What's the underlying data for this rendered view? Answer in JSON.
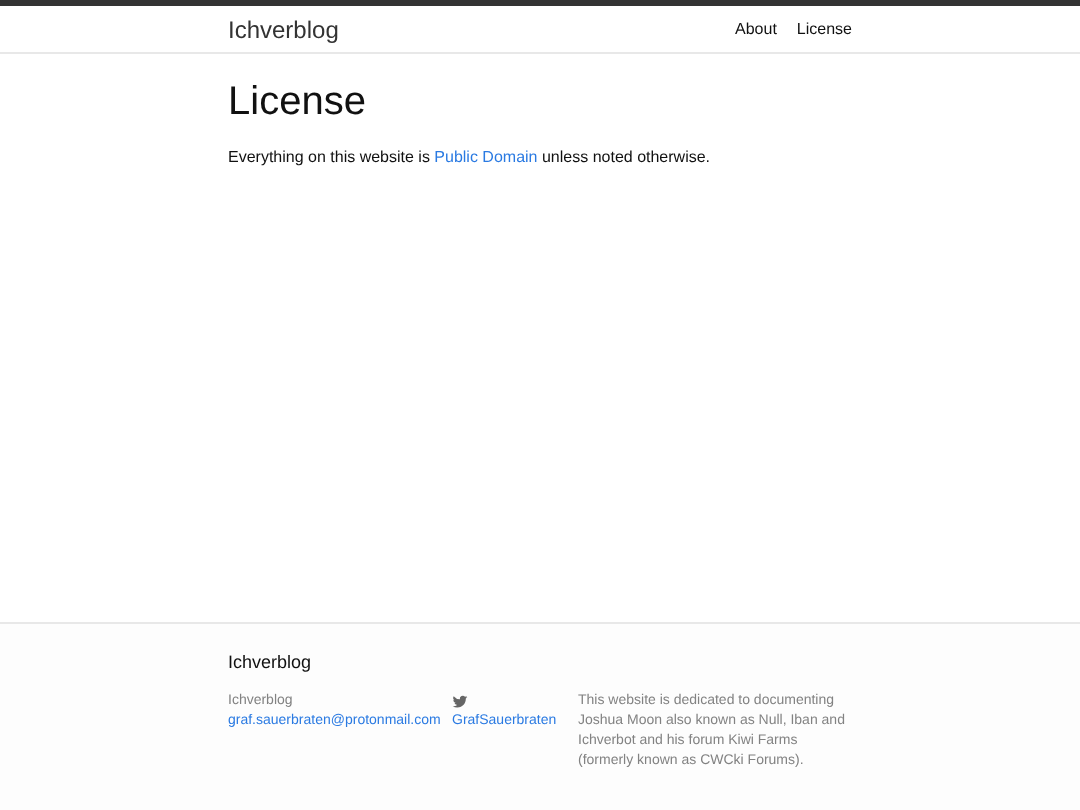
{
  "header": {
    "site_title": "Ichverblog",
    "nav": [
      "About",
      "License"
    ]
  },
  "page": {
    "title": "License",
    "text_before": "Everything on this website is ",
    "link": "Public Domain",
    "text_after": " unless noted otherwise."
  },
  "footer": {
    "title": "Ichverblog",
    "name": "Ichverblog",
    "email": "graf.sauerbraten@protonmail.com",
    "twitter": "GrafSauerbraten",
    "description": "This website is dedicated to documenting Joshua Moon also known as Null, Iban and Ichverbot and his forum Kiwi Farms (formerly known as CWCki Forums)."
  }
}
